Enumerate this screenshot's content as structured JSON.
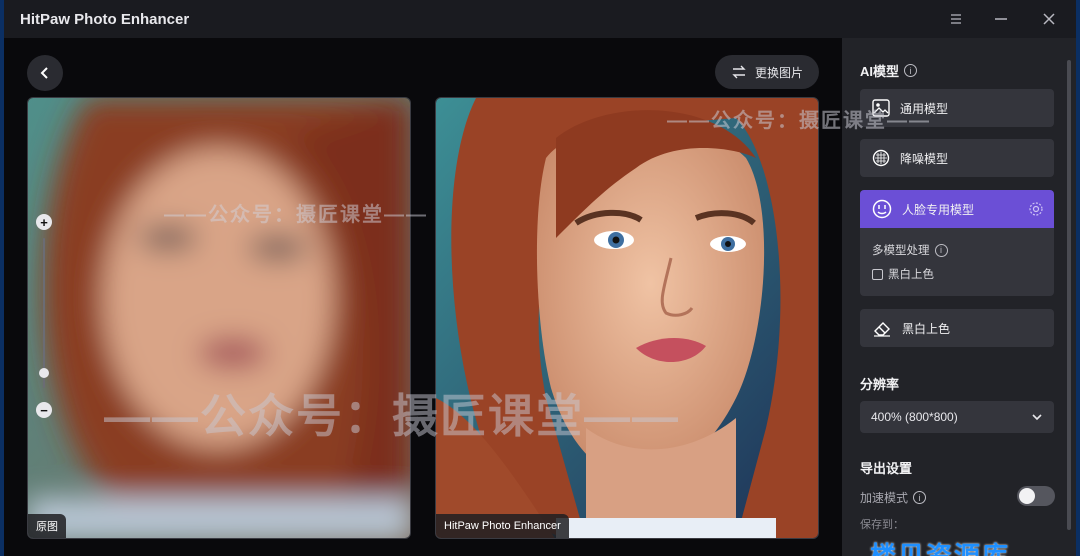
{
  "window": {
    "title": "HitPaw Photo Enhancer"
  },
  "toolbar": {
    "replace_label": "更换图片"
  },
  "images": {
    "left_label": "原图",
    "right_label": "HitPaw Photo Enhancer"
  },
  "watermarks": {
    "top": "——公众号：摄匠课堂——",
    "mid": "——公众号：摄匠课堂——",
    "big": "——公众号：摄匠课堂——",
    "site": "楼贝资源库"
  },
  "sidebar": {
    "ai_model_title": "AI模型",
    "models": [
      {
        "label": "通用模型",
        "icon": "image-icon"
      },
      {
        "label": "降噪模型",
        "icon": "noise-icon"
      },
      {
        "label": "人脸专用模型",
        "icon": "face-icon"
      }
    ],
    "multi_model_label": "多模型处理",
    "colorize_checkbox_label": "黑白上色",
    "colorize_model_label": "黑白上色",
    "resolution_title": "分辨率",
    "resolution_value": "400% (800*800)",
    "export_title": "导出设置",
    "accelerate_label": "加速模式",
    "save_to_label": "保存到："
  },
  "colors": {
    "accent": "#6b4fd6",
    "panel": "#222328",
    "button": "#34353c"
  }
}
